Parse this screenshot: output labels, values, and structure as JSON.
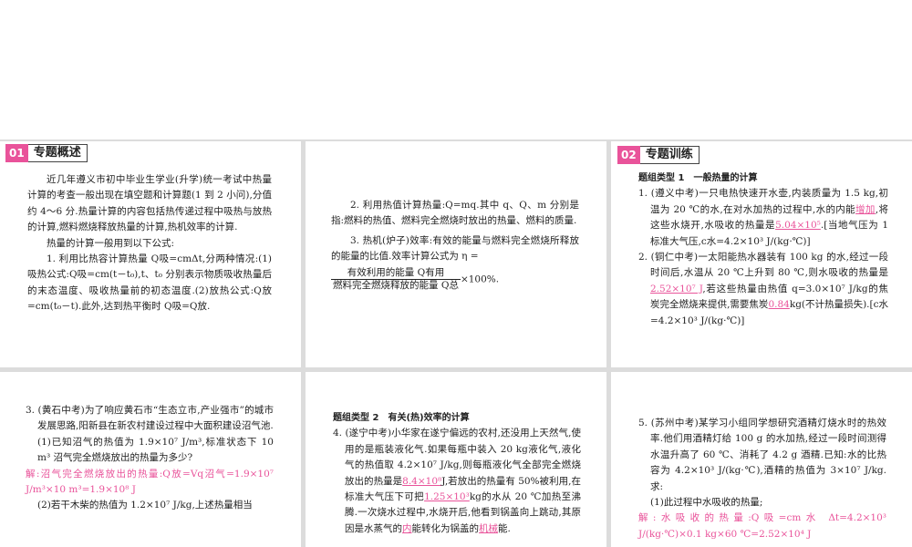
{
  "section1": {
    "num": "01",
    "title": "专题概述",
    "intro": "近几年遵义市初中毕业生学业(升学)统一考试中热量计算的考查一般出现在填空题和计算题(1 到 2 小问),分值约 4～6 分.热量计算的内容包括热传递过程中吸热与放热的计算,燃料燃烧释放热量的计算,热机效率的计算.",
    "formulas_intro": "热量的计算一般用到以下公式:",
    "item1": "1. 利用比热容计算热量 Q吸=cmΔt,分两种情况:(1)吸热公式:Q吸=cm(t－t₀),t、t₀ 分别表示物质吸收热量后的末态温度、吸收热量前的初态温度.(2)放热公式:Q放=cm(t₀－t).此外,达到热平衡时 Q吸=Q放.",
    "item2": "2. 利用热值计算热量:Q=mq.其中 q、Q、m 分别是指:燃料的热值、燃料完全燃烧时放出的热量、燃料的质量.",
    "item3": "3. 热机(炉子)效率:有效的能量与燃料完全燃烧所释放的能量的比值.效率计算公式为 η =",
    "frac_num": "有效利用的能量 Q有用",
    "frac_den": "燃料完全燃烧释放的能量 Q总",
    "frac_tail": "×100%."
  },
  "section2": {
    "num": "02",
    "title": "专题训练",
    "group1": "题组类型 1　一般热量的计算",
    "q1_a": "1. (遵义中考)一只电热快速开水壶,内装质量为 1.5 kg,初温为 20 ℃的水,在对水加热的过程中,水的内能",
    "q1_ans1": "增加",
    "q1_b": ",将这些水烧开,水吸收的热量是",
    "q1_ans2": "5.04×10⁵",
    "q1_c": ".[当地气压为 1 标准大气压,c水=4.2×10³ J/(kg·℃)]",
    "q2_a": "2. (铜仁中考)一太阳能热水器装有 100 kg 的水,经过一段时间后,水温从 20 ℃上升到 80 ℃,则水吸收的热量是",
    "q2_ans1": "2.52×10⁷ J",
    "q2_b": ",若这些热量由热值 q=3.0×10⁷ J/kg的焦炭完全燃烧来提供,需要焦炭",
    "q2_ans2": "0.84",
    "q2_c": "kg(不计热量损失).[c水=4.2×10³ J/(kg·℃)]",
    "q3_a": "3. (黄石中考)为了响应黄石市“生态立市,产业强市”的城市发展思路,阳新县在新农村建设过程中大面积建设沼气池.",
    "q3_1": "(1)已知沼气的热值为 1.9×10⁷ J/m³,标准状态下 10 m³ 沼气完全燃烧放出的热量为多少?",
    "q3_sol": "解:沼气完全燃烧放出的热量:Q放=Vq沼气=1.9×10⁷ J/m³×10 m³=1.9×10⁸ J",
    "q3_2": "(2)若干木柴的热值为 1.2×10⁷ J/kg,上述热量相当",
    "group2": "题组类型 2　有关(热)效率的计算",
    "q4_a": "4. (遂宁中考)小华家在遂宁偏远的农村,还没用上天然气,使用的是瓶装液化气.如果每瓶中装入 20 kg液化气,液化气的热值取 4.2×10⁷ J/kg,则每瓶液化气全部完全燃烧放出的热量是",
    "q4_ans1": "8.4×10⁸",
    "q4_b": "J,若放出的热量有 50%被利用,在标准大气压下可把",
    "q4_ans2": "1.25×10³",
    "q4_c": "kg的水从 20 ℃加热至沸腾.一次烧水过程中,水烧开后,他看到锅盖向上跳动,其原因是水蒸气的",
    "q4_ans3": "内",
    "q4_d": "能转化为锅盖的",
    "q4_ans4": "机械",
    "q4_e": "能.",
    "q5_a": "5. (苏州中考)某学习小组同学想研究酒精灯烧水时的热效率.他们用酒精灯给 100 g 的水加热,经过一段时间测得水温升高了 60 ℃、消耗了 4.2 g 酒精.已知:水的比热容为 4.2×10³ J/(kg·℃),酒精的热值为 3×10⁷ J/kg.求:",
    "q5_1": "(1)此过程中水吸收的热量;",
    "q5_sol": "解:水吸收的热量:Q吸=cm水 Δt=4.2×10³ J/(kg·℃)×0.1 kg×60 ℃=2.52×10⁴ J"
  },
  "colors": {
    "accent": "#e9539a",
    "background": "#dcdcdc"
  }
}
